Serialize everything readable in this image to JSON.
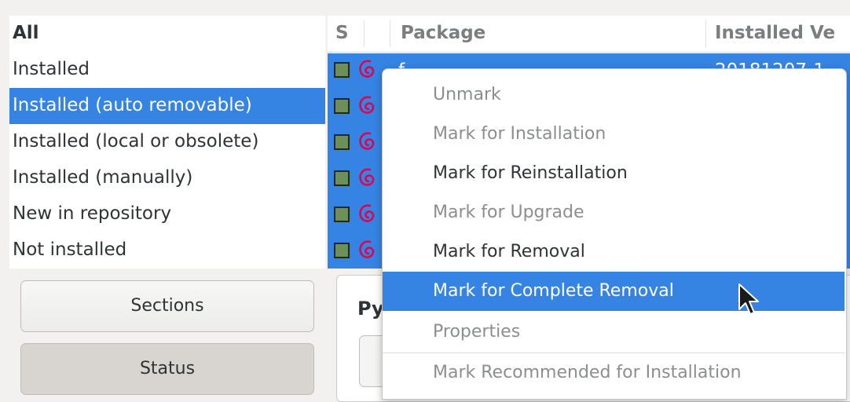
{
  "filters": {
    "items": [
      {
        "label": "All",
        "bold": true,
        "selected": false
      },
      {
        "label": "Installed",
        "bold": false,
        "selected": false
      },
      {
        "label": "Installed (auto removable)",
        "bold": false,
        "selected": true
      },
      {
        "label": "Installed (local or obsolete)",
        "bold": false,
        "selected": false
      },
      {
        "label": "Installed (manually)",
        "bold": false,
        "selected": false
      },
      {
        "label": "New in repository",
        "bold": false,
        "selected": false
      },
      {
        "label": "Not installed",
        "bold": false,
        "selected": false
      }
    ]
  },
  "side_buttons": {
    "sections": "Sections",
    "status": "Status"
  },
  "package_table": {
    "columns": {
      "s": "S",
      "package": "Package",
      "installed_version": "Installed Ve"
    },
    "rows": [
      {
        "name": "f",
        "version": "20181207-1"
      },
      {
        "name": "",
        "version": ""
      },
      {
        "name": "",
        "version": ""
      },
      {
        "name": "",
        "version": ""
      },
      {
        "name": "",
        "version": ""
      },
      {
        "name": "",
        "version": ""
      }
    ]
  },
  "details": {
    "title": "Py"
  },
  "context_menu": {
    "items": [
      {
        "label": "Unmark",
        "enabled": false,
        "highlighted": false
      },
      {
        "label": "Mark for Installation",
        "enabled": false,
        "highlighted": false
      },
      {
        "label": "Mark for Reinstallation",
        "enabled": true,
        "highlighted": false
      },
      {
        "label": "Mark for Upgrade",
        "enabled": false,
        "highlighted": false
      },
      {
        "label": "Mark for Removal",
        "enabled": true,
        "highlighted": false
      },
      {
        "label": "Mark for Complete Removal",
        "enabled": true,
        "highlighted": true
      },
      {
        "label": "Properties",
        "enabled": false,
        "highlighted": false
      },
      {
        "label": "Mark Recommended for Installation",
        "enabled": false,
        "highlighted": false
      }
    ]
  },
  "colors": {
    "selection": "#3584e4",
    "status_installed": "#6d8f5a",
    "debian_swirl": "#d70751"
  },
  "icons": {
    "status": "installed-status-icon",
    "package": "debian-swirl-icon",
    "cursor": "mouse-pointer-icon"
  }
}
